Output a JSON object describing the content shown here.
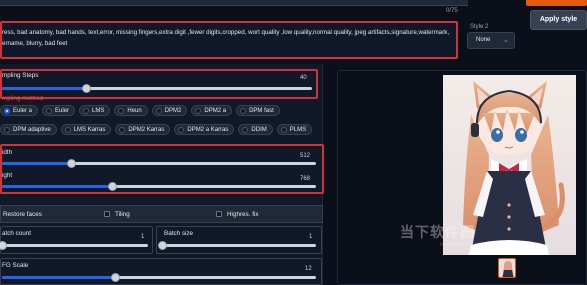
{
  "prompt": {
    "counter": "0/75",
    "negative_text": "ress, bad anatomy, bad hands, text,error, missing fingers,extra digit ,fewer digits,cropped, wort quality ,low quality,normal quality, jpeg artifacts,signature,watermark,\nername, blurry, bad feet"
  },
  "styles": {
    "label": "Style 2",
    "value": "None"
  },
  "buttons": {
    "apply_style": "Apply style"
  },
  "sampling": {
    "steps_label": "mpling Steps",
    "steps_value": "40",
    "steps_fraction": 0.27,
    "method_label": "mpling method",
    "methods_row1": [
      "Euler a",
      "Euler",
      "LMS",
      "Heun",
      "DPM2",
      "DPM2 a",
      "DPM fast"
    ],
    "methods_row2": [
      "DPM adaptive",
      "LMS Karras",
      "DPM2 Karras",
      "DPM2 a Karras",
      "DDIM",
      "PLMS"
    ],
    "selected": "Euler a"
  },
  "size": {
    "width_label": "idth",
    "width_value": "512",
    "width_fraction": 0.22,
    "height_label": "ight",
    "height_value": "768",
    "height_fraction": 0.35
  },
  "options": {
    "restore_faces": "Restore faces",
    "tiling": "Tiling",
    "highres_fix": "Highres. fix"
  },
  "batch": {
    "count_label": "atch count",
    "count_value": "1",
    "size_label": "Batch size",
    "size_value": "1"
  },
  "cfg": {
    "label": "FG Scale",
    "value": "12",
    "fraction": 0.36
  },
  "watermark": {
    "text": "当下软件园",
    "sub": "www.downxia.com"
  },
  "colors": {
    "accent_blue": "#2563eb",
    "highlight_red": "#d0343b",
    "brand_orange": "#e35a0d",
    "background": "#0b0f19"
  }
}
